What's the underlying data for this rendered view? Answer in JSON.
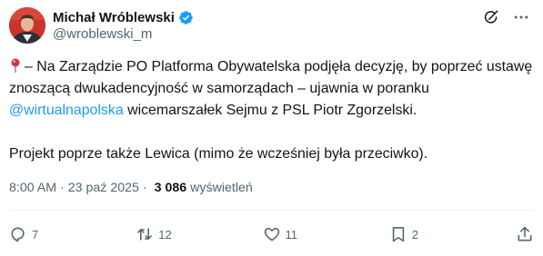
{
  "author": {
    "display_name": "Michał Wróblewski",
    "handle": "@wroblewski_m",
    "verified_color": "#1d9bf0",
    "avatar_bg": "#c9342c"
  },
  "icons": {
    "pin": "round-pushpin-icon",
    "verified": "verified-badge-icon",
    "grok": "grok-icon",
    "more": "more-icon",
    "reply": "reply-icon",
    "repost": "repost-icon",
    "like": "like-icon",
    "bookmark": "bookmark-icon",
    "share": "share-icon"
  },
  "tweet": {
    "line1": "– Na Zarządzie PO Platforma Obywatelska podjęła decyzję, by poprzeć ustawę znoszącą dwukadencyjność w samorządach – ujawnia w poranku ",
    "mention": "@wirtualnapolska",
    "line1_end": " wicemarszałek Sejmu z PSL Piotr Zgorzelski.",
    "line2": "Projekt poprze także Lewica (mimo że wcześniej była przeciwko)."
  },
  "meta": {
    "time": "8:00 AM",
    "separator": "·",
    "date": "23 paź 2025",
    "views_count": "3 086",
    "views_label": "wyświetleń"
  },
  "actions": {
    "replies": "7",
    "reposts": "12",
    "likes": "11",
    "bookmarks": "2"
  },
  "colors": {
    "text": "#0f1419",
    "secondary": "#536471",
    "link": "#1d9bf0",
    "divider": "#eff3f4"
  }
}
